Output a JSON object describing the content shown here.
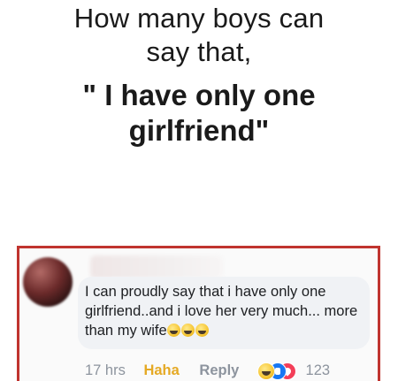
{
  "header": {
    "line1": "How many boys can",
    "line2": "say that,",
    "line3": "\" I have only one",
    "line4": "girlfriend\""
  },
  "comment": {
    "text": "I can proudly say that i have only one girlfriend..and i love her very much... more than my wife",
    "emoji": [
      "laughing-emoji",
      "laughing-emoji",
      "laughing-emoji"
    ]
  },
  "actions": {
    "time": "17 hrs",
    "haha": "Haha",
    "reply": "Reply",
    "reaction_icons": [
      "haha-reaction-icon",
      "like-reaction-icon",
      "love-reaction-icon"
    ],
    "reaction_count": "123"
  },
  "colors": {
    "frame_border": "#c0342f",
    "haha_label": "#e5a924",
    "muted_text": "#8d949e",
    "bubble": "#f0f2f5",
    "like_blue": "#1877f2",
    "love_red": "#f33e58"
  }
}
